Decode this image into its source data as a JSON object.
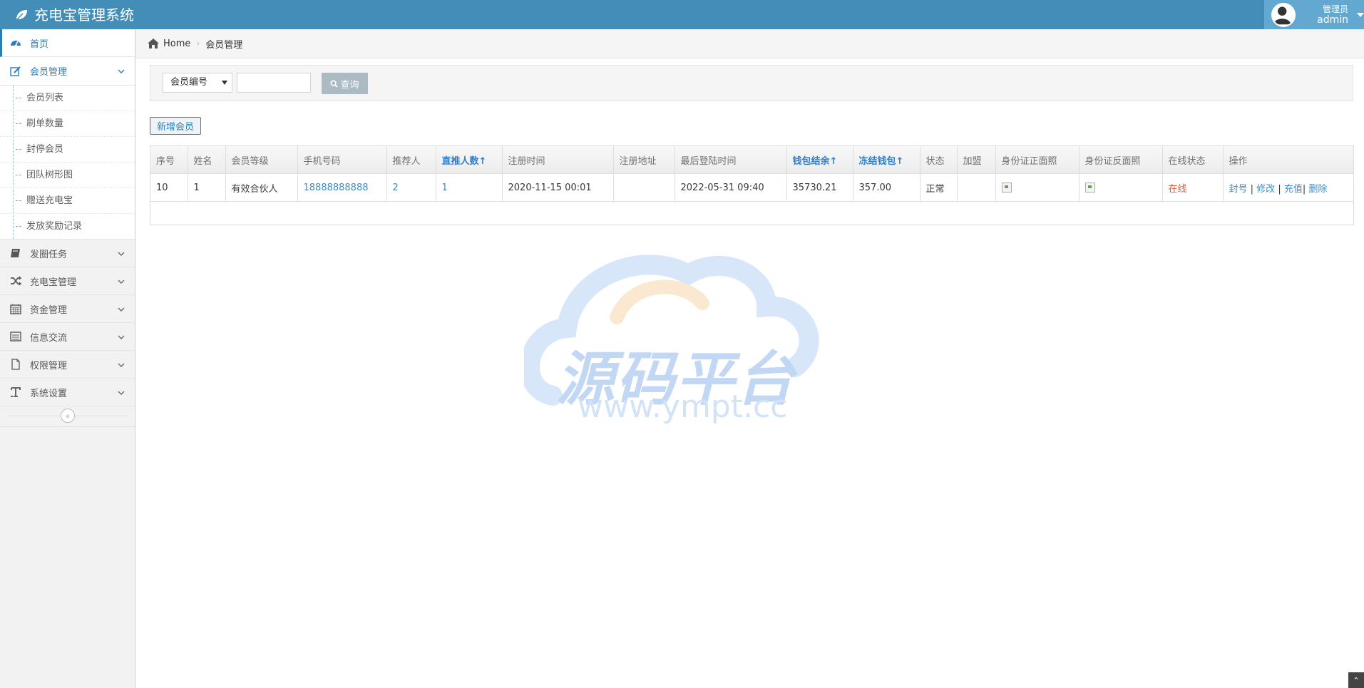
{
  "app": {
    "title": "充电宝管理系统",
    "user_role": "管理员",
    "user_name": "admin"
  },
  "sidebar": {
    "items": [
      {
        "label": "首页",
        "icon": "dashboard-icon"
      },
      {
        "label": "会员管理",
        "icon": "edit-icon",
        "open": true,
        "children": [
          "会员列表",
          "刷单数量",
          "封停会员",
          "团队树形图",
          "赠送充电宝",
          "发放奖励记录"
        ]
      },
      {
        "label": "发圈任务",
        "icon": "book-icon"
      },
      {
        "label": "充电宝管理",
        "icon": "shuffle-icon"
      },
      {
        "label": "资金管理",
        "icon": "calendar-icon"
      },
      {
        "label": "信息交流",
        "icon": "list-icon"
      },
      {
        "label": "权限管理",
        "icon": "file-icon"
      },
      {
        "label": "系统设置",
        "icon": "text-icon"
      }
    ],
    "collapse_glyph": "«"
  },
  "breadcrumb": {
    "home": "Home",
    "current": "会员管理"
  },
  "search": {
    "field_selected": "会员编号",
    "input_value": "",
    "query_label": "查询"
  },
  "actions": {
    "add_member": "新增会员"
  },
  "table": {
    "columns": [
      "序号",
      "姓名",
      "会员等级",
      "手机号码",
      "推荐人",
      "直推人数↑",
      "注册时间",
      "注册地址",
      "最后登陆时间",
      "钱包结余↑",
      "冻结钱包↑",
      "状态",
      "加盟",
      "身份证正面照",
      "身份证反面照",
      "在线状态",
      "操作"
    ],
    "rows": [
      {
        "id": "10",
        "name": "1",
        "level": "有效合伙人",
        "phone": "18888888888",
        "referrer": "2",
        "direct_count": "1",
        "reg_time": "2020-11-15 00:01",
        "reg_addr": "",
        "last_login": "2022-05-31 09:40",
        "wallet": "35730.21",
        "frozen": "357.00",
        "status": "正常",
        "join": "",
        "online": "在线",
        "ops": {
          "ban": "封号",
          "edit": "修改",
          "recharge": "充值",
          "delete": "删除"
        }
      }
    ]
  },
  "watermark": {
    "title": "源码平台",
    "url": "www.ympt.cc"
  },
  "colors": {
    "navbar": "#438eb9",
    "accent": "#2b7dbc",
    "online": "#dd5a43"
  }
}
